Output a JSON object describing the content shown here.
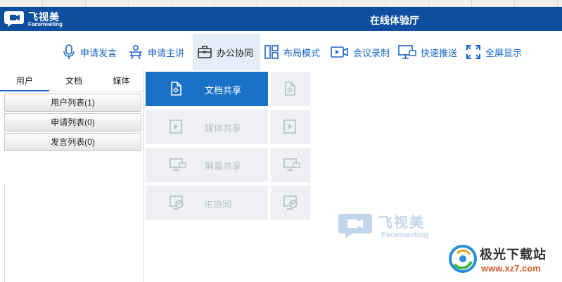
{
  "app": {
    "logo_name": "飞视美",
    "logo_sub": "Facemeeting",
    "window_title": "在线体验厅"
  },
  "toolbar": {
    "items": [
      {
        "label": "申请发言",
        "icon": "microphone-icon"
      },
      {
        "label": "申请主讲",
        "icon": "presenter-icon"
      },
      {
        "label": "办公协同",
        "icon": "briefcase-icon",
        "active": true
      },
      {
        "label": "布局模式",
        "icon": "layout-icon"
      },
      {
        "label": "会议录制",
        "icon": "video-record-icon"
      },
      {
        "label": "快速推送",
        "icon": "screen-push-icon"
      },
      {
        "label": "全屏显示",
        "icon": "fullscreen-icon"
      }
    ]
  },
  "left_panel": {
    "tabs": [
      {
        "label": "用户",
        "active": true
      },
      {
        "label": "文档"
      },
      {
        "label": "媒体"
      }
    ],
    "lists": [
      {
        "label": "用户列表(1)"
      },
      {
        "label": "申请列表(0)"
      },
      {
        "label": "发言列表(0)"
      }
    ]
  },
  "collab": {
    "tiles": [
      {
        "label": "文档共享",
        "icon": "document-icon",
        "active": true
      },
      {
        "label": "媒体共享",
        "icon": "media-play-icon"
      },
      {
        "label": "屏幕共享",
        "icon": "screen-share-icon"
      },
      {
        "label": "IE协同",
        "icon": "ie-browser-icon"
      }
    ]
  },
  "watermark": {
    "name": "飞视美",
    "sub": "Facemeeting"
  },
  "site_badge": {
    "name": "极光下载站",
    "url": "www.xz7.com"
  },
  "colors": {
    "titlebar": "#0d4e9f",
    "accent": "#1a72c8",
    "toolbar_text": "#1a66c8",
    "tile_bg": "#eef0f4"
  }
}
